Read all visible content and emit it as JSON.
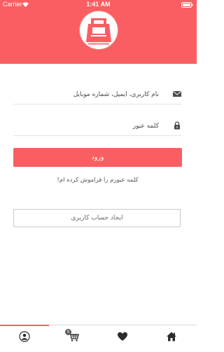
{
  "status_bar": {
    "carrier": "Carrier",
    "time": "1:41 AM"
  },
  "header": {
    "logo": "shopping-bag-logo",
    "background_color": "#f95f62"
  },
  "form": {
    "username": {
      "value": "",
      "placeholder": "نام کاربری، ایمیل، شماره موبایل",
      "icon": "envelope-icon"
    },
    "password": {
      "value": "",
      "placeholder": "کلمه عبور",
      "icon": "lock-icon"
    },
    "login_label": "ورود",
    "forgot_label": "کلمه عبورم را فراموش کرده ام!",
    "register_label": "ایجاد حساب کاربری"
  },
  "tab_bar": {
    "active_tab": "profile",
    "accent_color": "#f95f62",
    "tabs": [
      {
        "name": "profile",
        "icon": "user-icon"
      },
      {
        "name": "cart",
        "icon": "cart-icon",
        "badge": "0"
      },
      {
        "name": "favorites",
        "icon": "heart-icon"
      },
      {
        "name": "home",
        "icon": "home-icon"
      }
    ]
  }
}
